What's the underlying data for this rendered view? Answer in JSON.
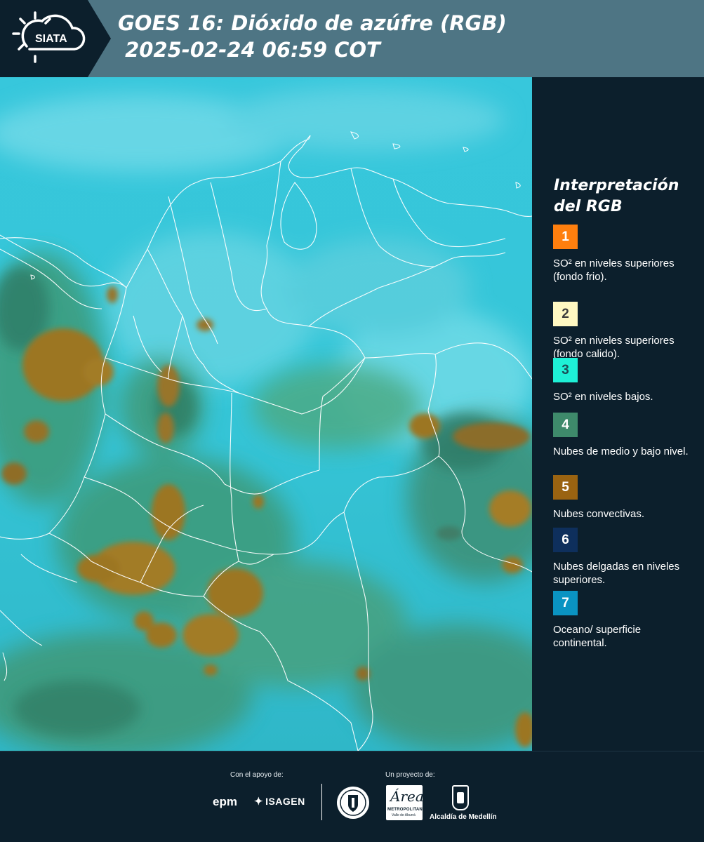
{
  "header": {
    "logo_text": "SIATA",
    "title_line1": "GOES 16: Dióxido de azúfre (RGB)",
    "title_line2": " 2025-02-24 06:59 COT"
  },
  "legend": {
    "title": "Interpretación del RGB",
    "items": [
      {
        "number": "1",
        "color": "#ff7f0e",
        "text_color": "#ffffff",
        "description": "SO² en niveles superiores (fondo frio)."
      },
      {
        "number": "2",
        "color": "#fff8c2",
        "text_color": "#3d3d3d",
        "description": "SO² en niveles superiores (fondo calido)."
      },
      {
        "number": "3",
        "color": "#1ef0d6",
        "text_color": "#1b4b55",
        "description": "SO² en niveles bajos."
      },
      {
        "number": "4",
        "color": "#3e8a6b",
        "text_color": "#ffffff",
        "description": "Nubes de medio y bajo nivel."
      },
      {
        "number": "5",
        "color": "#9a6311",
        "text_color": "#ffffff",
        "description": "Nubes convectivas."
      },
      {
        "number": "6",
        "color": "#0e2f5c",
        "text_color": "#ffffff",
        "description": "Nubes delgadas en niveles superiores."
      },
      {
        "number": "7",
        "color": "#0a93c2",
        "text_color": "#ffffff",
        "description": "Oceano/ superficie continental."
      }
    ]
  },
  "footer": {
    "support_label": "Con el apoyo de:",
    "project_label": "Un proyecto de:",
    "epm": "epm",
    "isagen": "ISAGEN",
    "area_logo": "Área",
    "area_sub": "METROPOLITANA",
    "area_sub2": "Valle de Aburrá",
    "alcaldia": "Alcaldía de Medellín"
  },
  "colors": {
    "header_bg": "#4e7584",
    "panel_bg": "#0c1f2c",
    "surface_cyan": "#2ec8d8",
    "cloud_green": "#3e8a6b",
    "convective_brown": "#9a6311"
  }
}
